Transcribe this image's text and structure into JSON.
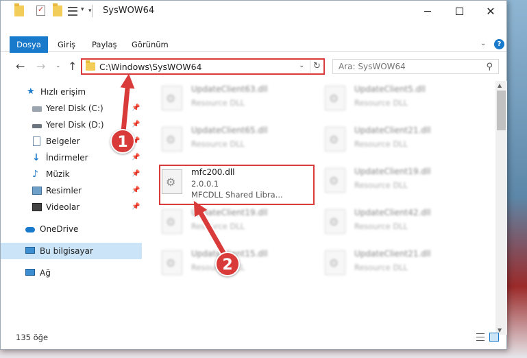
{
  "window": {
    "title": "SysWOW64"
  },
  "ribbon": {
    "tabs": [
      "Dosya",
      "Giriş",
      "Paylaş",
      "Görünüm"
    ],
    "help": "?"
  },
  "address": {
    "path": "C:\\Windows\\SysWOW64",
    "search_placeholder": "Ara: SysWOW64"
  },
  "navpane": {
    "items": [
      {
        "label": "Hızlı erişim",
        "icon": "star-icon",
        "pinned": false
      },
      {
        "label": "Yerel Disk (C:)",
        "icon": "drive-icon",
        "pinned": true
      },
      {
        "label": "Yerel Disk (D:)",
        "icon": "drive-icon",
        "pinned": true
      },
      {
        "label": "Belgeler",
        "icon": "document-icon",
        "pinned": true
      },
      {
        "label": "İndirmeler",
        "icon": "download-icon",
        "pinned": true
      },
      {
        "label": "Müzik",
        "icon": "music-icon",
        "pinned": true
      },
      {
        "label": "Resimler",
        "icon": "pictures-icon",
        "pinned": true
      },
      {
        "label": "Videolar",
        "icon": "video-icon",
        "pinned": true
      },
      {
        "label": "OneDrive",
        "icon": "cloud-icon",
        "pinned": false
      },
      {
        "label": "Bu bilgisayar",
        "icon": "computer-icon",
        "pinned": false,
        "selected": true
      },
      {
        "label": "Ağ",
        "icon": "network-icon",
        "pinned": false
      }
    ]
  },
  "files": [
    {
      "name": "UpdateClient63.dll",
      "desc": "Resource DLL",
      "blurred": true
    },
    {
      "name": "UpdateClient5.dll",
      "desc": "Resource DLL",
      "blurred": true
    },
    {
      "name": "UpdateClient65.dll",
      "desc": "Resource DLL",
      "blurred": true
    },
    {
      "name": "UpdateClient21.dll",
      "desc": "Resource DLL",
      "blurred": true
    },
    {
      "name": "mfc200.dll",
      "version": "2.0.0.1",
      "desc": "MFCDLL Shared Libra...",
      "blurred": false
    },
    {
      "name": "UpdateClient19.dll",
      "desc": "Resource DLL",
      "blurred": true
    },
    {
      "name": "UpdateClient19.dll",
      "desc": "Resource DLL",
      "blurred": true
    },
    {
      "name": "UpdateClient42.dll",
      "desc": "Resource DLL",
      "blurred": true
    },
    {
      "name": "UpdateClient15.dll",
      "desc": "Resource DLL",
      "blurred": true
    },
    {
      "name": "UpdateClient21.dll",
      "desc": "Resource DLL",
      "blurred": true
    }
  ],
  "status": {
    "count": "135 öğe"
  },
  "callouts": {
    "one": "1",
    "two": "2"
  },
  "colors": {
    "accent": "#1979ca",
    "callout": "#d93a3a"
  }
}
